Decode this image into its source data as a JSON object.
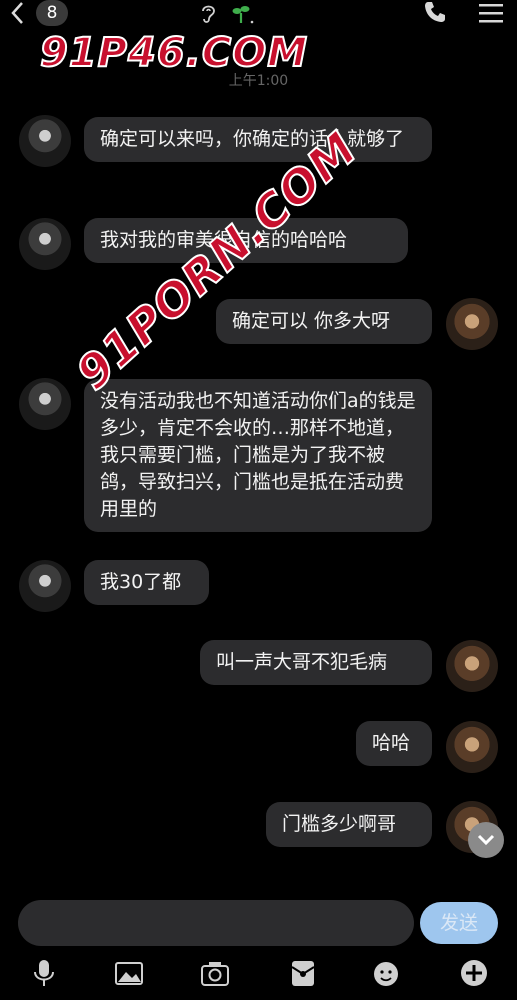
{
  "header": {
    "unread_count": "8"
  },
  "timestamp": "上午1:00",
  "watermarks": [
    "91P46.COM",
    "91PORN.COM"
  ],
  "messages": [
    {
      "side": "left",
      "text": "确定可以来吗，你确定的话人就够了"
    },
    {
      "side": "left",
      "text": "我对我的审美很自信的哈哈哈"
    },
    {
      "side": "right",
      "text": "确定可以 你多大呀"
    },
    {
      "side": "left",
      "text": "没有活动我也不知道活动你们a的钱是多少，肯定不会收的…那样不地道，我只需要门槛，门槛是为了我不被鸽，导致扫兴，门槛也是抵在活动费用里的"
    },
    {
      "side": "left",
      "text": "我30了都"
    },
    {
      "side": "right",
      "text": "叫一声大哥不犯毛病"
    },
    {
      "side": "right",
      "text": "哈哈"
    },
    {
      "side": "right",
      "text": "门槛多少啊哥"
    }
  ],
  "composer": {
    "send_label": "发送"
  },
  "toolbar": [
    "mic-icon",
    "image-icon",
    "camera-icon",
    "redpacket-icon",
    "emoji-icon",
    "plus-icon"
  ]
}
